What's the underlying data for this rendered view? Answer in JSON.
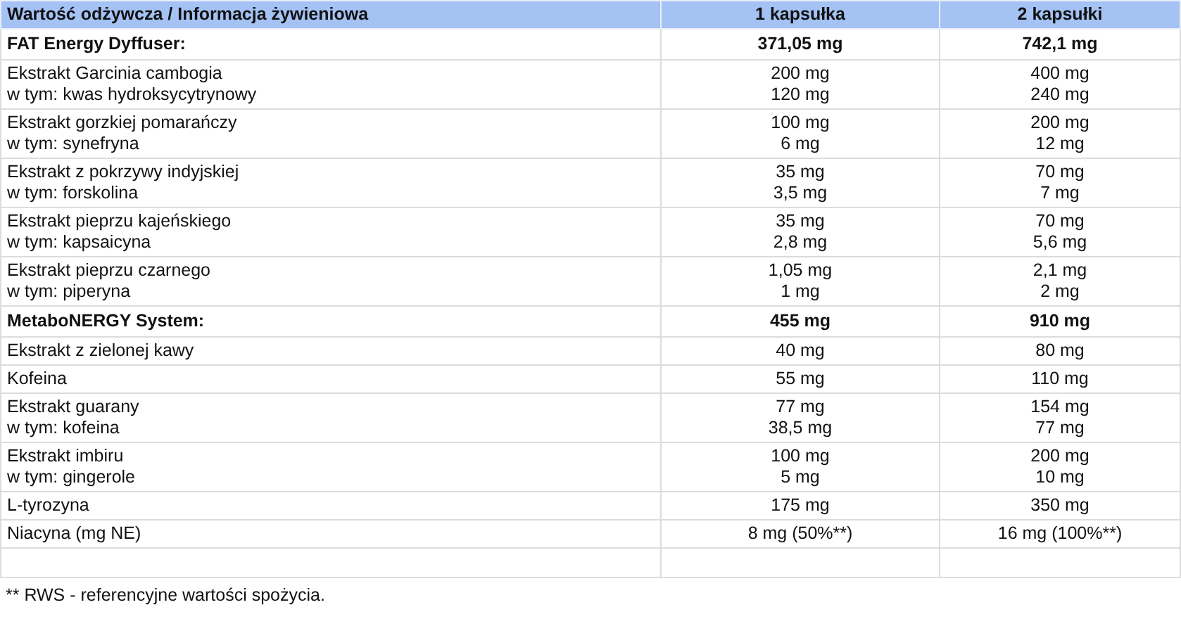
{
  "table": {
    "columns": [
      "Wartość odżywcza / Informacja żywieniowa",
      "1 kapsułka",
      "2 kapsułki"
    ],
    "rows": [
      {
        "kind": "section",
        "label": [
          "FAT Energy Dyffuser:"
        ],
        "one": [
          "371,05 mg"
        ],
        "two": [
          "742,1 mg"
        ]
      },
      {
        "kind": "item",
        "label": [
          "Ekstrakt Garcinia cambogia",
          "w tym: kwas hydroksycytrynowy"
        ],
        "one": [
          "200 mg",
          "120 mg"
        ],
        "two": [
          "400 mg",
          "240 mg"
        ]
      },
      {
        "kind": "item",
        "label": [
          "Ekstrakt gorzkiej pomarańczy",
          "w tym: synefryna"
        ],
        "one": [
          "100 mg",
          "6 mg"
        ],
        "two": [
          "200 mg",
          "12 mg"
        ]
      },
      {
        "kind": "item",
        "label": [
          "Ekstrakt z pokrzywy indyjskiej",
          "w tym: forskolina"
        ],
        "one": [
          "35 mg",
          "3,5 mg"
        ],
        "two": [
          "70 mg",
          "7 mg"
        ]
      },
      {
        "kind": "item",
        "label": [
          "Ekstrakt pieprzu kajeńskiego",
          "w tym: kapsaicyna"
        ],
        "one": [
          "35 mg",
          "2,8 mg"
        ],
        "two": [
          "70 mg",
          "5,6 mg"
        ]
      },
      {
        "kind": "item",
        "label": [
          "Ekstrakt pieprzu czarnego",
          "w tym: piperyna"
        ],
        "one": [
          "1,05 mg",
          "1 mg"
        ],
        "two": [
          "2,1 mg",
          "2 mg"
        ]
      },
      {
        "kind": "section",
        "label": [
          "MetaboNERGY System:"
        ],
        "one": [
          "455 mg"
        ],
        "two": [
          "910 mg"
        ]
      },
      {
        "kind": "item",
        "label": [
          "Ekstrakt z zielonej kawy"
        ],
        "one": [
          "40 mg"
        ],
        "two": [
          "80 mg"
        ]
      },
      {
        "kind": "item",
        "label": [
          "Kofeina"
        ],
        "one": [
          "55 mg"
        ],
        "two": [
          "110 mg"
        ]
      },
      {
        "kind": "item",
        "label": [
          "Ekstrakt guarany",
          "w tym: kofeina"
        ],
        "one": [
          "77 mg",
          "38,5 mg"
        ],
        "two": [
          "154 mg",
          "77 mg"
        ]
      },
      {
        "kind": "item",
        "label": [
          "Ekstrakt imbiru",
          "w tym: gingerole"
        ],
        "one": [
          "100 mg",
          "5 mg"
        ],
        "two": [
          "200 mg",
          "10 mg"
        ]
      },
      {
        "kind": "item",
        "label": [
          "L-tyrozyna"
        ],
        "one": [
          "175 mg"
        ],
        "two": [
          "350 mg"
        ]
      },
      {
        "kind": "item",
        "label": [
          "Niacyna (mg NE)"
        ],
        "one": [
          "8 mg (50%**)"
        ],
        "two": [
          "16 mg (100%**)"
        ]
      }
    ]
  },
  "footnote": "** RWS - referencyjne wartości spożycia."
}
